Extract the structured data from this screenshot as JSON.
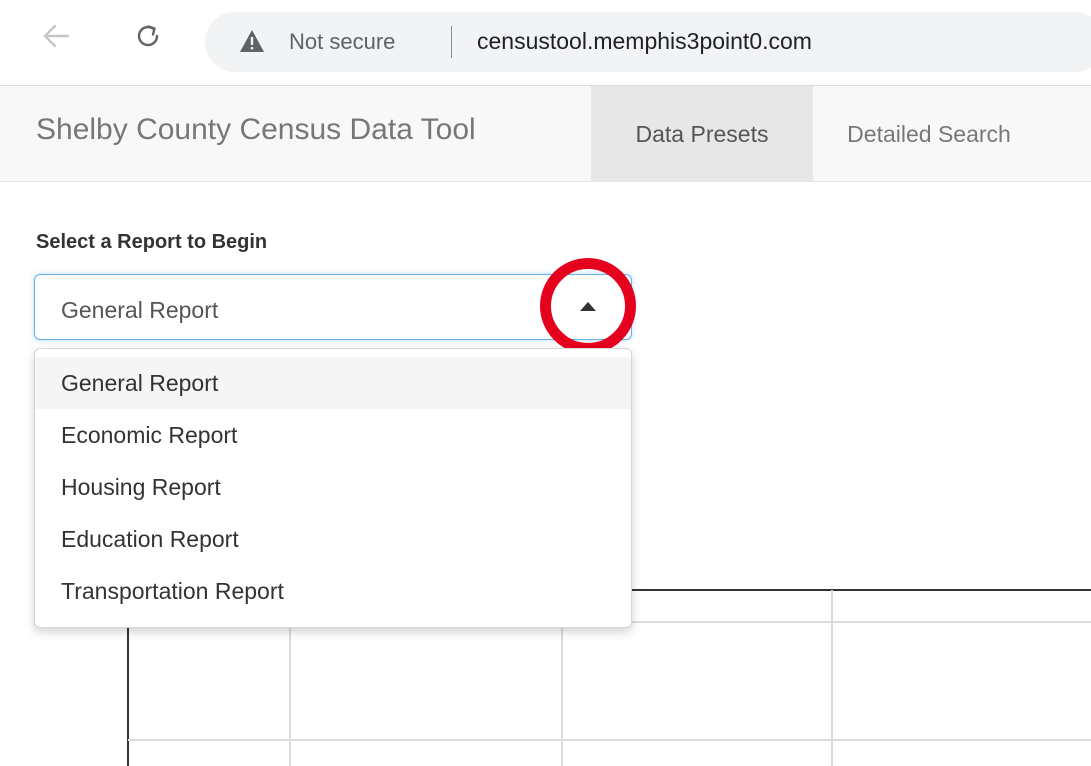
{
  "browser": {
    "security_label": "Not secure",
    "url": "censustool.memphis3point0.com"
  },
  "navbar": {
    "brand": "Shelby County Census Data Tool",
    "tabs": [
      {
        "label": "Data Presets",
        "active": true
      },
      {
        "label": "Detailed Search",
        "active": false
      }
    ]
  },
  "report_select": {
    "label": "Select a Report to Begin",
    "selected": "General Report",
    "options": [
      "General Report",
      "Economic Report",
      "Housing Report",
      "Education Report",
      "Transportation Report"
    ]
  },
  "colors": {
    "highlight_circle": "#e5001e",
    "focus_border": "#66afe9",
    "active_tab": "#e7e7e7"
  }
}
